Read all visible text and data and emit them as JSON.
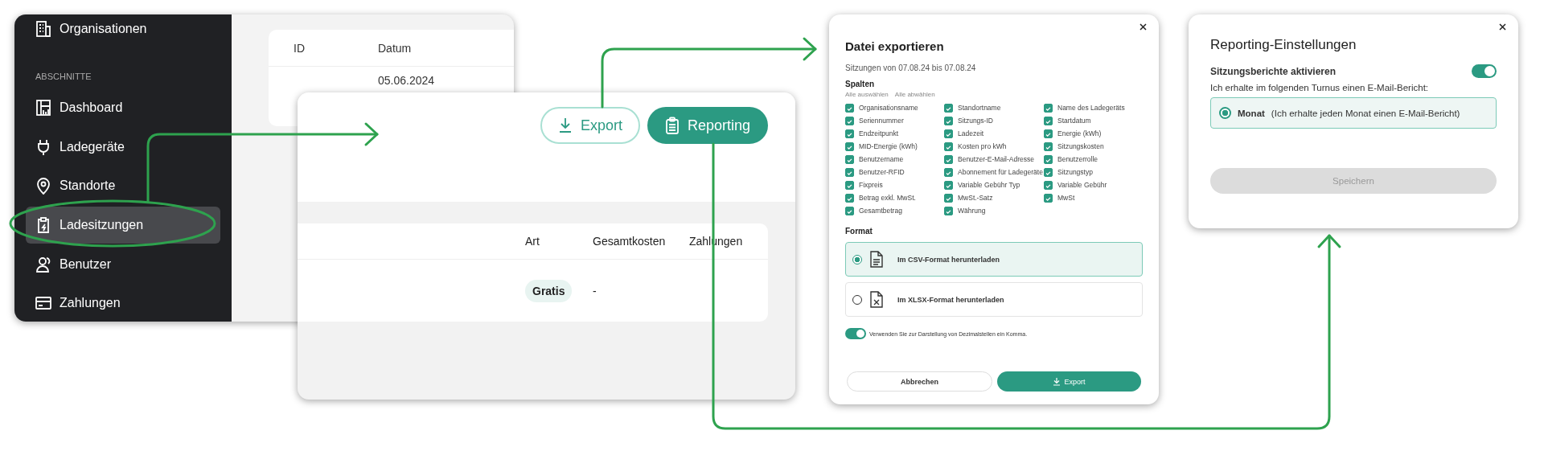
{
  "sessions_app": {
    "organisation_item": {
      "label": "Organisationen"
    },
    "section_label": "ABSCHNITTE",
    "sidebar_items": [
      {
        "label": "Dashboard",
        "selected": false
      },
      {
        "label": "Ladegeräte",
        "selected": false
      },
      {
        "label": "Standorte",
        "selected": false
      },
      {
        "label": "Ladesitzungen",
        "selected": true
      },
      {
        "label": "Benutzer",
        "selected": false
      },
      {
        "label": "Zahlungen",
        "selected": false
      }
    ],
    "table": {
      "columns": [
        "ID",
        "Datum"
      ],
      "rows": [
        {
          "datum": "05.06.2024"
        }
      ]
    }
  },
  "sessions_panel": {
    "buttons": [
      {
        "label": "Export",
        "kind": "outline"
      },
      {
        "label": "Reporting",
        "kind": "filled"
      }
    ],
    "table": {
      "columns": [
        "Art",
        "Gesamtkosten",
        "Zahlungen"
      ],
      "rows": [
        {
          "art": "Gratis",
          "gesamtkosten": "-"
        }
      ]
    }
  },
  "export_dialog": {
    "title": "Datei exportieren",
    "subtitle": "Sitzungen von 07.08.24 bis 07.08.24",
    "columns_heading": "Spalten",
    "select_all": "Alle auswählen",
    "deselect_all": "Alle abwählen",
    "columns": [
      {
        "label": "Organisationsname",
        "checked": true
      },
      {
        "label": "Standortname",
        "checked": true
      },
      {
        "label": "Name des Ladegeräts",
        "checked": true
      },
      {
        "label": "Seriennummer",
        "checked": true
      },
      {
        "label": "Sitzungs-ID",
        "checked": true
      },
      {
        "label": "Startdatum",
        "checked": true
      },
      {
        "label": "Endzeitpunkt",
        "checked": true
      },
      {
        "label": "Ladezeit",
        "checked": true
      },
      {
        "label": "Energie (kWh)",
        "checked": true
      },
      {
        "label": "MID-Energie (kWh)",
        "checked": true
      },
      {
        "label": "Kosten pro kWh",
        "checked": true
      },
      {
        "label": "Sitzungskosten",
        "checked": true
      },
      {
        "label": "Benutzername",
        "checked": true
      },
      {
        "label": "Benutzer-E-Mail-Adresse",
        "checked": true
      },
      {
        "label": "Benutzerrolle",
        "checked": true
      },
      {
        "label": "Benutzer-RFID",
        "checked": true
      },
      {
        "label": "Abonnement für Ladegeräte",
        "checked": true
      },
      {
        "label": "Sitzungstyp",
        "checked": true
      },
      {
        "label": "Fixpreis",
        "checked": true
      },
      {
        "label": "Variable Gebühr Typ",
        "checked": true
      },
      {
        "label": "Variable Gebühr",
        "checked": true
      },
      {
        "label": "Betrag exkl. MwSt.",
        "checked": true
      },
      {
        "label": "MwSt.-Satz",
        "checked": true
      },
      {
        "label": "MwSt",
        "checked": true
      },
      {
        "label": "Gesamtbetrag",
        "checked": true
      },
      {
        "label": "Währung",
        "checked": true
      }
    ],
    "format_heading": "Format",
    "formats": [
      {
        "label": "Im CSV-Format herunterladen",
        "kind": "csv",
        "selected": true
      },
      {
        "label": "Im XLSX-Format herunterladen",
        "kind": "xlsx",
        "selected": false
      }
    ],
    "decimal_comma": {
      "label": "Verwenden Sie zur Darstellung von Dezimalstellen ein Komma.",
      "on": true
    },
    "buttons": [
      {
        "label": "Abbrechen",
        "kind": "secondary"
      },
      {
        "label": "Export",
        "kind": "primary"
      }
    ]
  },
  "reporting_dialog": {
    "title": "Reporting-Einstellungen",
    "enable": {
      "label": "Sitzungsberichte aktivieren",
      "on": true
    },
    "frequency_prompt": "Ich erhalte im folgenden Turnus einen E-Mail-Bericht:",
    "options": [
      {
        "label": "Monat",
        "detail": "(Ich erhalte jeden Monat einen E-Mail-Bericht)",
        "selected": true
      }
    ],
    "save_button": {
      "label": "Speichern",
      "disabled": true
    }
  }
}
